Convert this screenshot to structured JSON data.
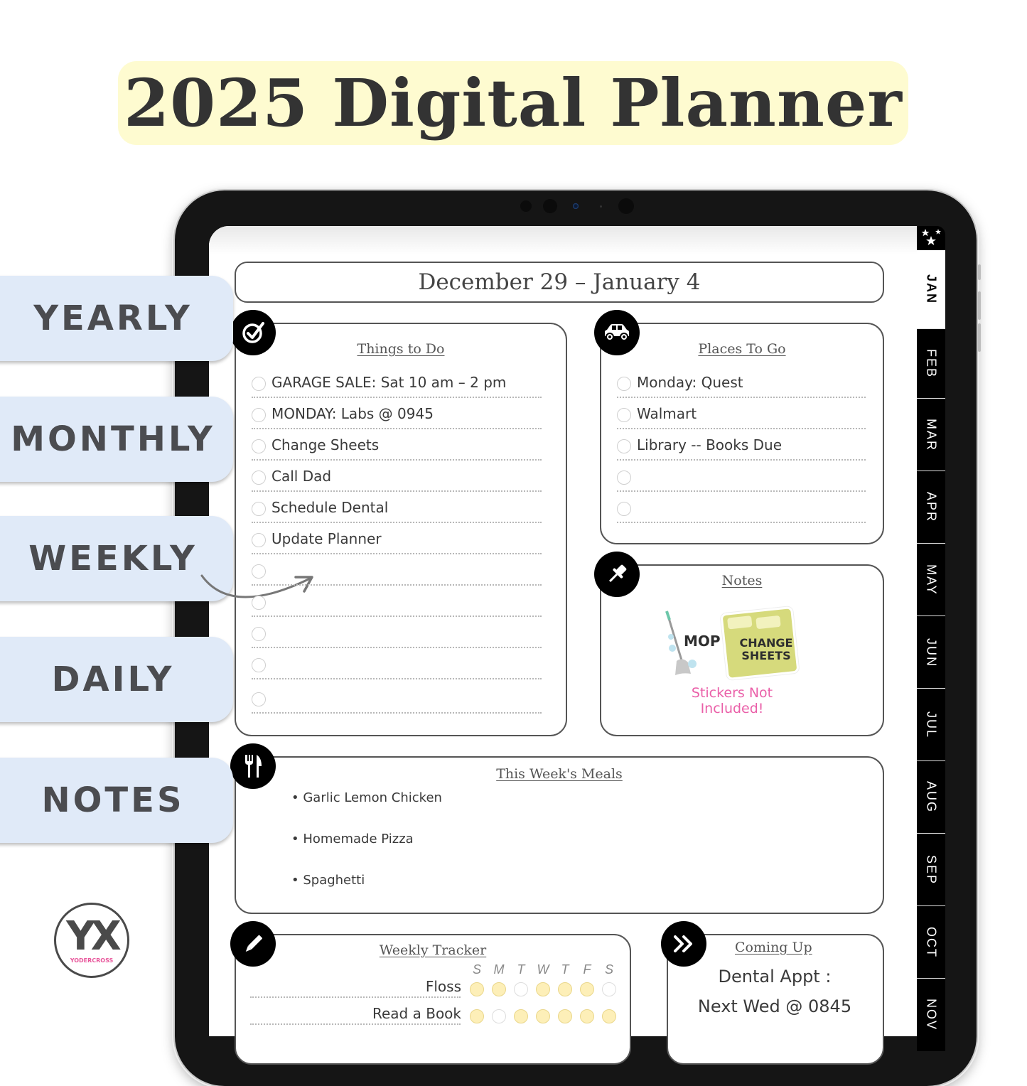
{
  "title": "2025 Digital Planner",
  "colors": {
    "title_bg": "#fefbd0",
    "side_tab_bg": "#e0eaf8",
    "tracker_on": "#fdefb8",
    "sticker_note": "#ea5fa8",
    "tablet_bezel": "#151515"
  },
  "side_tabs": [
    {
      "label": "YEARLY"
    },
    {
      "label": "MONTHLY"
    },
    {
      "label": "WEEKLY"
    },
    {
      "label": "DAILY"
    },
    {
      "label": "NOTES"
    }
  ],
  "month_tabs": {
    "star_icon": "stars-icon",
    "active": "JAN",
    "items": [
      "JAN",
      "FEB",
      "MAR",
      "APR",
      "MAY",
      "JUN",
      "JUL",
      "AUG",
      "SEP",
      "OCT",
      "NOV"
    ]
  },
  "week": {
    "range": "December 29 – January 4"
  },
  "things_to_do": {
    "title": "Things to Do",
    "icon": "check-circle-icon",
    "items": [
      "GARAGE SALE: Sat 10 am – 2 pm",
      "MONDAY: Labs @ 0945",
      "Change Sheets",
      "Call Dad",
      "Schedule Dental",
      "Update Planner",
      "",
      "",
      "",
      "",
      ""
    ]
  },
  "places_to_go": {
    "title": "Places To Go",
    "icon": "car-icon",
    "items": [
      "Monday: Quest",
      "Walmart",
      "Library -- Books Due",
      "",
      ""
    ]
  },
  "notes": {
    "title": "Notes",
    "icon": "pushpin-icon",
    "stickers": [
      {
        "label": "MOP"
      },
      {
        "label_line1": "CHANGE",
        "label_line2": "SHEETS"
      }
    ],
    "sticker_note_line1": "Stickers Not",
    "sticker_note_line2": "Included!"
  },
  "meals": {
    "title": "This Week's Meals",
    "icon": "fork-knife-icon",
    "items": [
      "Garlic Lemon Chicken",
      "Homemade Pizza",
      "Spaghetti"
    ]
  },
  "tracker": {
    "title": "Weekly Tracker",
    "icon": "pencil-icon",
    "days": [
      "S",
      "M",
      "T",
      "W",
      "T",
      "F",
      "S"
    ],
    "habits": [
      {
        "name": "Floss",
        "done": [
          true,
          true,
          false,
          true,
          true,
          true,
          false
        ]
      },
      {
        "name": "Read a Book",
        "done": [
          true,
          false,
          true,
          true,
          true,
          true,
          true
        ]
      }
    ]
  },
  "coming_up": {
    "title": "Coming Up",
    "icon": "double-chevron-right-icon",
    "line1": "Dental Appt :",
    "line2": "Next Wed @ 0845"
  },
  "logo": {
    "mark": "YX",
    "name": "YODERCROSS"
  }
}
